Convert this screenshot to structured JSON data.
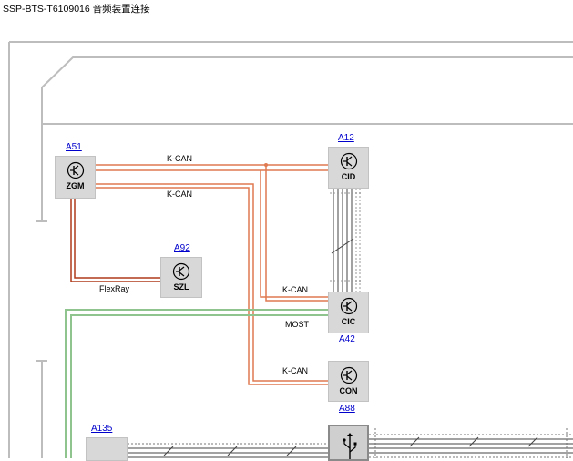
{
  "title": "SSP-BTS-T6109016 音频装置连接",
  "components": {
    "zgm": {
      "ref": "A51",
      "abbr": "ZGM",
      "icon": "transistor-icon"
    },
    "cid": {
      "ref": "A12",
      "abbr": "CID",
      "icon": "transistor-icon"
    },
    "szl": {
      "ref": "A92",
      "abbr": "SZL",
      "icon": "transistor-icon"
    },
    "cic": {
      "ref": "A42",
      "abbr": "CIC",
      "icon": "transistor-icon"
    },
    "con": {
      "ref": "A88",
      "abbr": "CON",
      "icon": "transistor-icon"
    },
    "usb": {
      "ref": "A135",
      "icon": "usb-icon"
    }
  },
  "bus_labels": {
    "kcan_cid": "K-CAN",
    "kcan_cic_top": "K-CAN",
    "flexray": "FlexRay",
    "kcan_cic": "K-CAN",
    "most": "MOST",
    "kcan_con": "K-CAN"
  },
  "colors": {
    "kcan": "#e07a50",
    "flexray": "#b03a1a",
    "most": "#8fc48f",
    "frame": "#bdbdbd",
    "link": "#0000cc"
  }
}
